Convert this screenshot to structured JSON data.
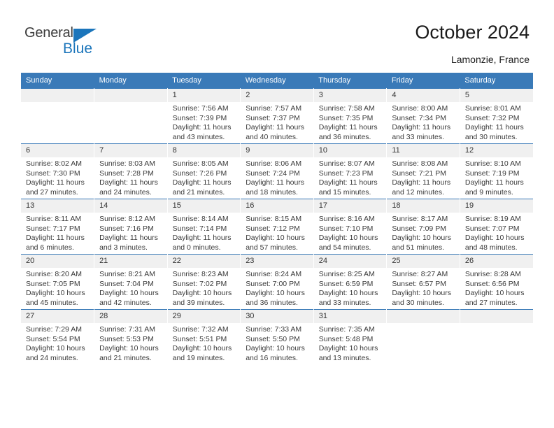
{
  "brand": {
    "name_part1": "General",
    "name_part2": "Blue",
    "logo_icon": "blue-triangle-icon",
    "color_blue": "#1b75bb"
  },
  "header": {
    "title": "October 2024",
    "location": "Lamonzie, France"
  },
  "theme": {
    "header_blue": "#3a7ab8",
    "daynum_band": "#f0f0f0",
    "text": "#333333"
  },
  "weekdays": [
    "Sunday",
    "Monday",
    "Tuesday",
    "Wednesday",
    "Thursday",
    "Friday",
    "Saturday"
  ],
  "weeks": [
    [
      {
        "day": "",
        "empty": true
      },
      {
        "day": "",
        "empty": true
      },
      {
        "day": "1",
        "sunrise": "Sunrise: 7:56 AM",
        "sunset": "Sunset: 7:39 PM",
        "daylight1": "Daylight: 11 hours",
        "daylight2": "and 43 minutes."
      },
      {
        "day": "2",
        "sunrise": "Sunrise: 7:57 AM",
        "sunset": "Sunset: 7:37 PM",
        "daylight1": "Daylight: 11 hours",
        "daylight2": "and 40 minutes."
      },
      {
        "day": "3",
        "sunrise": "Sunrise: 7:58 AM",
        "sunset": "Sunset: 7:35 PM",
        "daylight1": "Daylight: 11 hours",
        "daylight2": "and 36 minutes."
      },
      {
        "day": "4",
        "sunrise": "Sunrise: 8:00 AM",
        "sunset": "Sunset: 7:34 PM",
        "daylight1": "Daylight: 11 hours",
        "daylight2": "and 33 minutes."
      },
      {
        "day": "5",
        "sunrise": "Sunrise: 8:01 AM",
        "sunset": "Sunset: 7:32 PM",
        "daylight1": "Daylight: 11 hours",
        "daylight2": "and 30 minutes."
      }
    ],
    [
      {
        "day": "6",
        "sunrise": "Sunrise: 8:02 AM",
        "sunset": "Sunset: 7:30 PM",
        "daylight1": "Daylight: 11 hours",
        "daylight2": "and 27 minutes."
      },
      {
        "day": "7",
        "sunrise": "Sunrise: 8:03 AM",
        "sunset": "Sunset: 7:28 PM",
        "daylight1": "Daylight: 11 hours",
        "daylight2": "and 24 minutes."
      },
      {
        "day": "8",
        "sunrise": "Sunrise: 8:05 AM",
        "sunset": "Sunset: 7:26 PM",
        "daylight1": "Daylight: 11 hours",
        "daylight2": "and 21 minutes."
      },
      {
        "day": "9",
        "sunrise": "Sunrise: 8:06 AM",
        "sunset": "Sunset: 7:24 PM",
        "daylight1": "Daylight: 11 hours",
        "daylight2": "and 18 minutes."
      },
      {
        "day": "10",
        "sunrise": "Sunrise: 8:07 AM",
        "sunset": "Sunset: 7:23 PM",
        "daylight1": "Daylight: 11 hours",
        "daylight2": "and 15 minutes."
      },
      {
        "day": "11",
        "sunrise": "Sunrise: 8:08 AM",
        "sunset": "Sunset: 7:21 PM",
        "daylight1": "Daylight: 11 hours",
        "daylight2": "and 12 minutes."
      },
      {
        "day": "12",
        "sunrise": "Sunrise: 8:10 AM",
        "sunset": "Sunset: 7:19 PM",
        "daylight1": "Daylight: 11 hours",
        "daylight2": "and 9 minutes."
      }
    ],
    [
      {
        "day": "13",
        "sunrise": "Sunrise: 8:11 AM",
        "sunset": "Sunset: 7:17 PM",
        "daylight1": "Daylight: 11 hours",
        "daylight2": "and 6 minutes."
      },
      {
        "day": "14",
        "sunrise": "Sunrise: 8:12 AM",
        "sunset": "Sunset: 7:16 PM",
        "daylight1": "Daylight: 11 hours",
        "daylight2": "and 3 minutes."
      },
      {
        "day": "15",
        "sunrise": "Sunrise: 8:14 AM",
        "sunset": "Sunset: 7:14 PM",
        "daylight1": "Daylight: 11 hours",
        "daylight2": "and 0 minutes."
      },
      {
        "day": "16",
        "sunrise": "Sunrise: 8:15 AM",
        "sunset": "Sunset: 7:12 PM",
        "daylight1": "Daylight: 10 hours",
        "daylight2": "and 57 minutes."
      },
      {
        "day": "17",
        "sunrise": "Sunrise: 8:16 AM",
        "sunset": "Sunset: 7:10 PM",
        "daylight1": "Daylight: 10 hours",
        "daylight2": "and 54 minutes."
      },
      {
        "day": "18",
        "sunrise": "Sunrise: 8:17 AM",
        "sunset": "Sunset: 7:09 PM",
        "daylight1": "Daylight: 10 hours",
        "daylight2": "and 51 minutes."
      },
      {
        "day": "19",
        "sunrise": "Sunrise: 8:19 AM",
        "sunset": "Sunset: 7:07 PM",
        "daylight1": "Daylight: 10 hours",
        "daylight2": "and 48 minutes."
      }
    ],
    [
      {
        "day": "20",
        "sunrise": "Sunrise: 8:20 AM",
        "sunset": "Sunset: 7:05 PM",
        "daylight1": "Daylight: 10 hours",
        "daylight2": "and 45 minutes."
      },
      {
        "day": "21",
        "sunrise": "Sunrise: 8:21 AM",
        "sunset": "Sunset: 7:04 PM",
        "daylight1": "Daylight: 10 hours",
        "daylight2": "and 42 minutes."
      },
      {
        "day": "22",
        "sunrise": "Sunrise: 8:23 AM",
        "sunset": "Sunset: 7:02 PM",
        "daylight1": "Daylight: 10 hours",
        "daylight2": "and 39 minutes."
      },
      {
        "day": "23",
        "sunrise": "Sunrise: 8:24 AM",
        "sunset": "Sunset: 7:00 PM",
        "daylight1": "Daylight: 10 hours",
        "daylight2": "and 36 minutes."
      },
      {
        "day": "24",
        "sunrise": "Sunrise: 8:25 AM",
        "sunset": "Sunset: 6:59 PM",
        "daylight1": "Daylight: 10 hours",
        "daylight2": "and 33 minutes."
      },
      {
        "day": "25",
        "sunrise": "Sunrise: 8:27 AM",
        "sunset": "Sunset: 6:57 PM",
        "daylight1": "Daylight: 10 hours",
        "daylight2": "and 30 minutes."
      },
      {
        "day": "26",
        "sunrise": "Sunrise: 8:28 AM",
        "sunset": "Sunset: 6:56 PM",
        "daylight1": "Daylight: 10 hours",
        "daylight2": "and 27 minutes."
      }
    ],
    [
      {
        "day": "27",
        "sunrise": "Sunrise: 7:29 AM",
        "sunset": "Sunset: 5:54 PM",
        "daylight1": "Daylight: 10 hours",
        "daylight2": "and 24 minutes."
      },
      {
        "day": "28",
        "sunrise": "Sunrise: 7:31 AM",
        "sunset": "Sunset: 5:53 PM",
        "daylight1": "Daylight: 10 hours",
        "daylight2": "and 21 minutes."
      },
      {
        "day": "29",
        "sunrise": "Sunrise: 7:32 AM",
        "sunset": "Sunset: 5:51 PM",
        "daylight1": "Daylight: 10 hours",
        "daylight2": "and 19 minutes."
      },
      {
        "day": "30",
        "sunrise": "Sunrise: 7:33 AM",
        "sunset": "Sunset: 5:50 PM",
        "daylight1": "Daylight: 10 hours",
        "daylight2": "and 16 minutes."
      },
      {
        "day": "31",
        "sunrise": "Sunrise: 7:35 AM",
        "sunset": "Sunset: 5:48 PM",
        "daylight1": "Daylight: 10 hours",
        "daylight2": "and 13 minutes."
      },
      {
        "day": "",
        "empty": true
      },
      {
        "day": "",
        "empty": true
      }
    ]
  ]
}
